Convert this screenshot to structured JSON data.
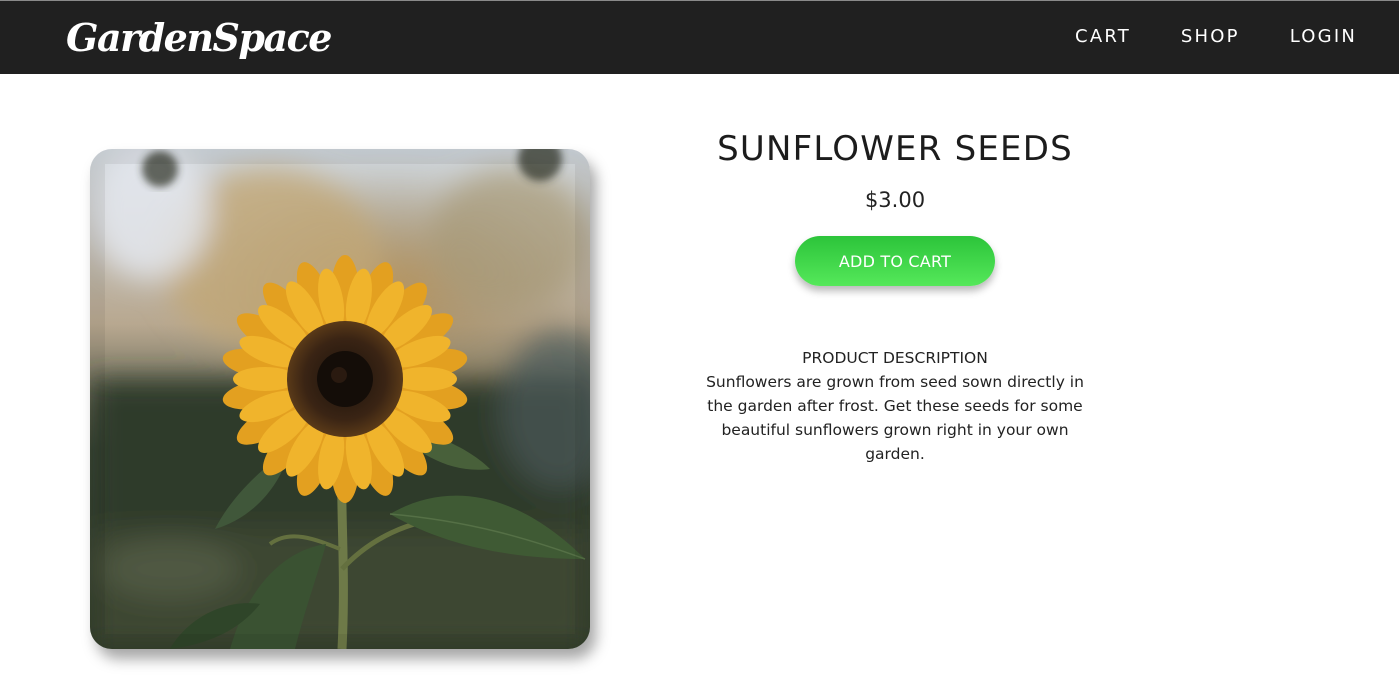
{
  "header": {
    "logo": "GardenSpace",
    "nav": [
      {
        "label": "CART"
      },
      {
        "label": "SHOP"
      },
      {
        "label": "LOGIN"
      }
    ]
  },
  "product": {
    "title": "SUNFLOWER SEEDS",
    "price": "$3.00",
    "add_to_cart_label": "ADD TO CART",
    "image": {
      "subject": "sunflower-photo",
      "alt": "Sunflower"
    },
    "description_heading": "PRODUCT DESCRIPTION",
    "description": "Sunflowers are grown from seed sown directly in the garden after frost. Get these seeds for some beautiful sunflowers grown right in your own garden."
  },
  "colors": {
    "header_bg": "#202020",
    "button_green": "#3ad448"
  }
}
